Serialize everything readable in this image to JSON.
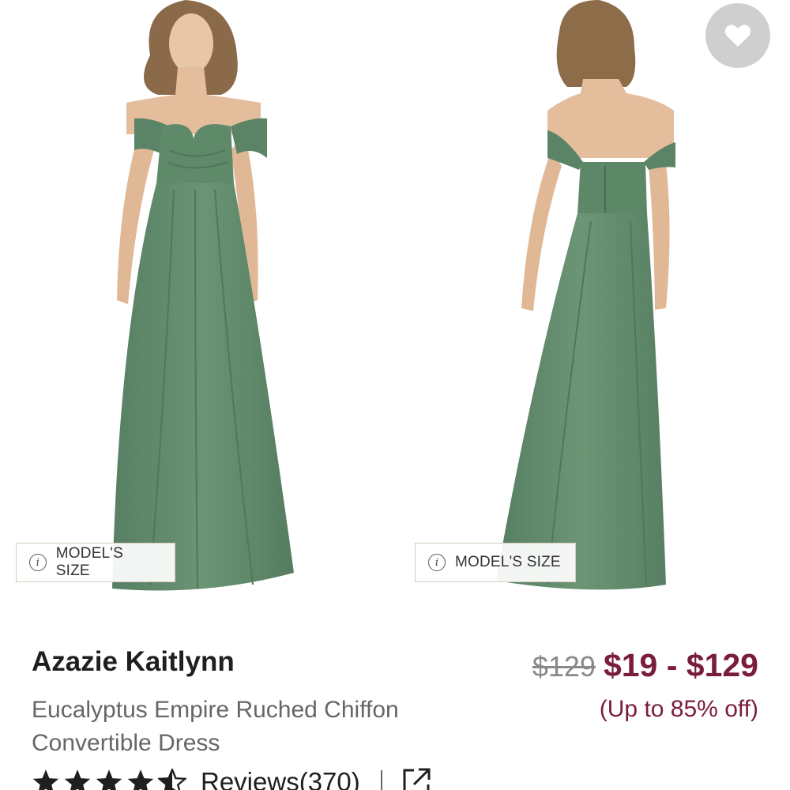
{
  "gallery": {
    "model_size_label": "MODEL'S SIZE",
    "dress_color": "#5e8a6b",
    "favorite_icon": "heart-icon"
  },
  "product": {
    "brand": "Azazie Kaitlynn",
    "description": "Eucalyptus Empire Ruched Chiffon Convertible Dress",
    "original_price": "$129",
    "price_range": "$19 - $129",
    "discount": "(Up to 85% off)",
    "rating": 4.5,
    "reviews_label": "Reviews(370)",
    "share_icon": "external-link-icon"
  },
  "colors": {
    "accent": "#7a1c3e",
    "text": "#1f1f1f",
    "muted": "#666666"
  }
}
